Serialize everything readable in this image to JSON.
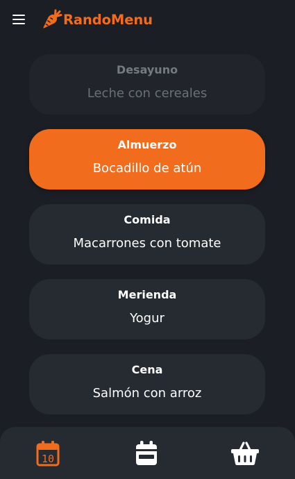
{
  "header": {
    "app_name": "RandoMenu",
    "menu_icon": "hamburger-icon",
    "logo_icon": "carrot-icon"
  },
  "meals": [
    {
      "title": "Desayuno",
      "dish": "Leche con cereales",
      "state": "past"
    },
    {
      "title": "Almuerzo",
      "dish": "Bocadillo de atún",
      "state": "current"
    },
    {
      "title": "Comida",
      "dish": "Macarrones con tomate",
      "state": "upcoming"
    },
    {
      "title": "Merienda",
      "dish": "Yogur",
      "state": "upcoming"
    },
    {
      "title": "Cena",
      "dish": "Salmón con arroz",
      "state": "upcoming"
    }
  ],
  "bottom_nav": {
    "items": [
      {
        "icon": "calendar-day-icon",
        "day_number": "10",
        "active": true
      },
      {
        "icon": "calendar-week-icon",
        "active": false
      },
      {
        "icon": "shopping-basket-icon",
        "active": false
      }
    ]
  },
  "colors": {
    "accent": "#f26c1e",
    "background": "#1b1f25",
    "card": "#262a31",
    "text": "#ffffff",
    "muted_text": "#757a80"
  }
}
